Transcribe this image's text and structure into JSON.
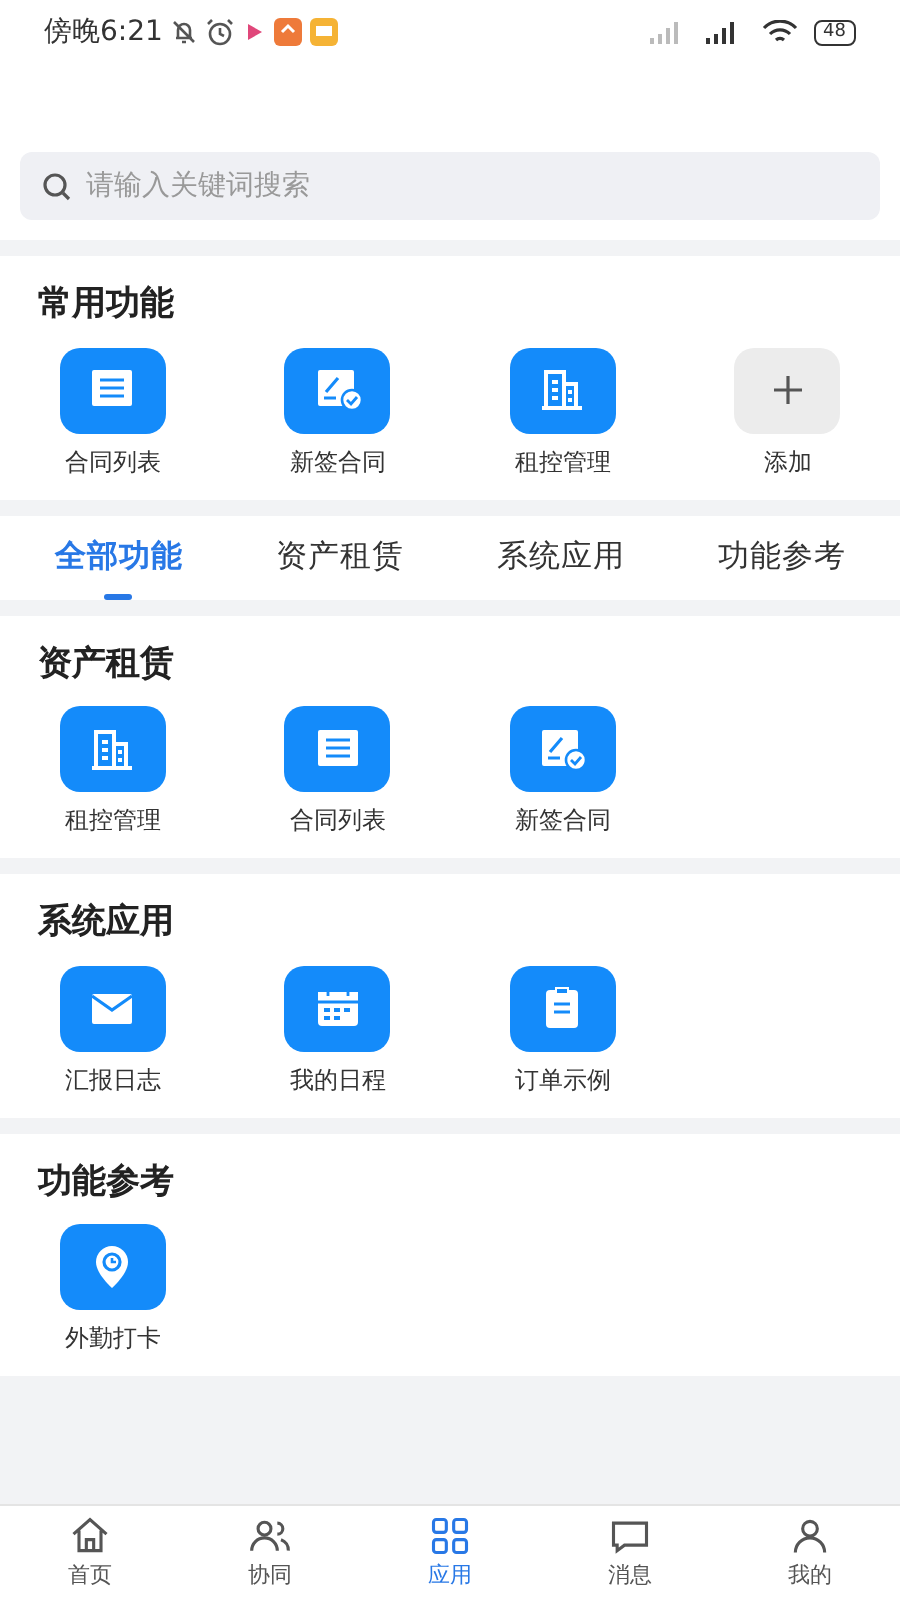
{
  "status_bar": {
    "time": "傍晚6:21",
    "battery": "48"
  },
  "search": {
    "placeholder": "请输入关键词搜索"
  },
  "favorites": {
    "title": "常用功能",
    "items": [
      {
        "label": "合同列表",
        "kind": "list"
      },
      {
        "label": "新签合同",
        "kind": "sign"
      },
      {
        "label": "租控管理",
        "kind": "building"
      },
      {
        "label": "添加",
        "kind": "add"
      }
    ]
  },
  "tabs": [
    {
      "label": "全部功能",
      "selected": true
    },
    {
      "label": "资产租赁",
      "selected": false
    },
    {
      "label": "系统应用",
      "selected": false
    },
    {
      "label": "功能参考",
      "selected": false
    }
  ],
  "sections": [
    {
      "title": "资产租赁",
      "items": [
        {
          "label": "租控管理",
          "kind": "building"
        },
        {
          "label": "合同列表",
          "kind": "list"
        },
        {
          "label": "新签合同",
          "kind": "sign"
        }
      ]
    },
    {
      "title": "系统应用",
      "items": [
        {
          "label": "汇报日志",
          "kind": "mail"
        },
        {
          "label": "我的日程",
          "kind": "calendar"
        },
        {
          "label": "订单示例",
          "kind": "clipboard"
        }
      ]
    },
    {
      "title": "功能参考",
      "items": [
        {
          "label": "外勤打卡",
          "kind": "location"
        }
      ]
    }
  ],
  "bottom_nav": [
    {
      "label": "首页",
      "kind": "home",
      "selected": false
    },
    {
      "label": "协同",
      "kind": "team",
      "selected": false
    },
    {
      "label": "应用",
      "kind": "apps",
      "selected": true
    },
    {
      "label": "消息",
      "kind": "message",
      "selected": false
    },
    {
      "label": "我的",
      "kind": "user",
      "selected": false
    }
  ]
}
